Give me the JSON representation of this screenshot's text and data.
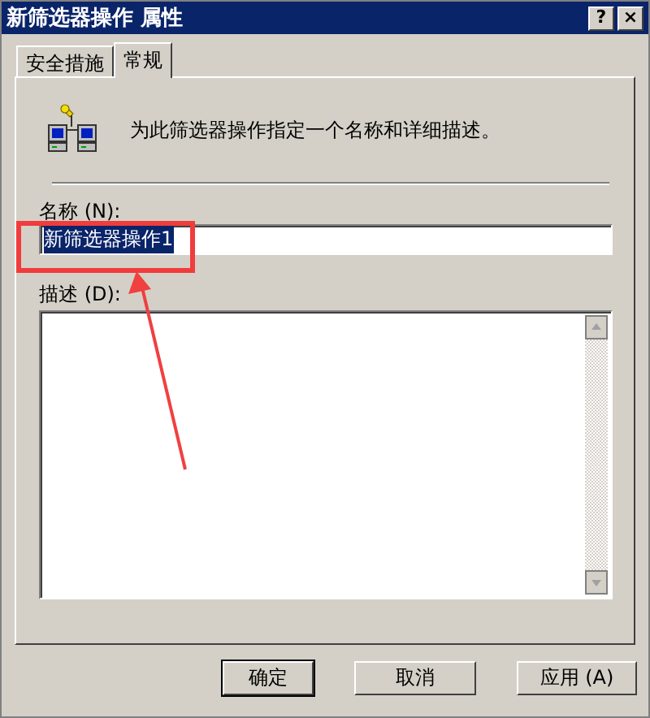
{
  "window": {
    "title": "新筛选器操作 属性",
    "help": "?",
    "close": "×"
  },
  "tabs": [
    {
      "label": "安全措施",
      "selected": false
    },
    {
      "label": "常规",
      "selected": true
    }
  ],
  "intro": "为此筛选器操作指定一个名称和详细描述。",
  "name_field": {
    "label": "名称 (N):",
    "value": "新筛选器操作1",
    "selected_text": true
  },
  "description_field": {
    "label": "描述 (D):"
  },
  "buttons": [
    {
      "label": "确定",
      "default": true
    },
    {
      "label": "取消",
      "default": false
    },
    {
      "label": "应用 (A)",
      "default": false
    }
  ]
}
